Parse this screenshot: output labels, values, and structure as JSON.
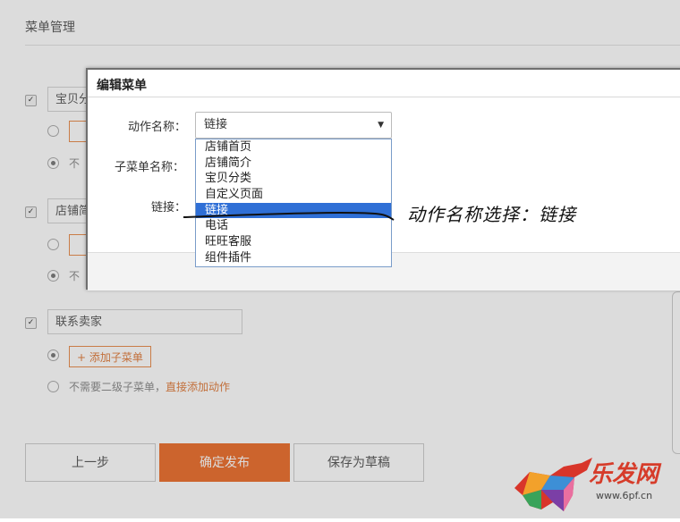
{
  "page": {
    "title": "菜单管理",
    "menus": [
      {
        "name": "宝贝分",
        "checked": true,
        "add_sub_label": "",
        "no_sub_text": "不"
      },
      {
        "name": "店铺简",
        "checked": true,
        "add_sub_label": "",
        "no_sub_text": "不"
      },
      {
        "name": "联系卖家",
        "checked": true,
        "add_sub_label": "+ 添加子菜单",
        "no_sub_text": "不需要二级子菜单，",
        "direct_link": "直接添加动作"
      }
    ],
    "buttons": {
      "prev": "上一步",
      "publish": "确定发布",
      "draft": "保存为草稿"
    },
    "accent_color": "#ec6d2a"
  },
  "dialog": {
    "title": "编辑菜单",
    "labels": {
      "action_name": "动作名称：",
      "submenu_name": "子菜单名称：",
      "link": "链接："
    },
    "select": {
      "value": "链接",
      "options": [
        "店铺首页",
        "店铺简介",
        "宝贝分类",
        "自定义页面",
        "链接",
        "电话",
        "旺旺客服",
        "组件插件"
      ],
      "selected_index": 4,
      "highlight_color": "#2f6fd6"
    }
  },
  "annotation": {
    "text": "动作名称选择：链接"
  },
  "watermark": {
    "brand": "乐发网",
    "url": "www.6pf.cn"
  }
}
